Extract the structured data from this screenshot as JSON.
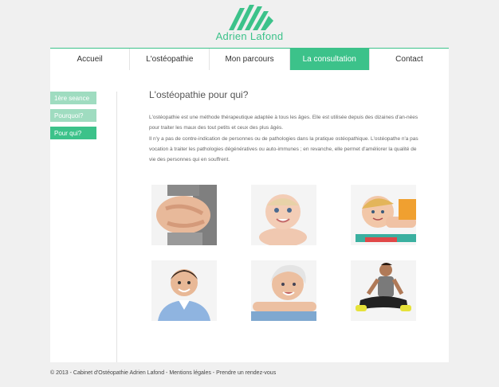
{
  "brand": {
    "name": "Adrien Lafond",
    "accent_color": "#3cc28a",
    "light_accent": "#9fdcc0"
  },
  "nav": {
    "items": [
      {
        "label": "Accueil",
        "active": false
      },
      {
        "label": "L'ostéopathie",
        "active": false
      },
      {
        "label": "Mon parcours",
        "active": false
      },
      {
        "label": "La consultation",
        "active": true
      },
      {
        "label": "Contact",
        "active": false
      }
    ]
  },
  "side_menu": {
    "items": [
      {
        "label": "1ère seance",
        "active": false
      },
      {
        "label": "Pourquoi?",
        "active": false
      },
      {
        "label": "Pour qui?",
        "active": true
      }
    ]
  },
  "main": {
    "title": "L'ostéopathie pour qui?",
    "paragraph1": "L'ostéopathie est une méthode thérapeutique adaptée à tous les âges. Elle est utilisée depuis des dizaines d'an-nées pour traiter les maux des tout petits et ceux des plus âgés.",
    "paragraph2": "Il n'y a pas de contre-indication de personnes ou de pathologies dans la pratique ostéopathique. L'ostéopathe n'a pas vocation à traiter les pathologies dégénératives ou auto-immunes ; en revanche, elle permet d'améliorer la qualité de vie des personnes qui en souffrent.",
    "photos": [
      {
        "icon": "pregnant-belly-photo"
      },
      {
        "icon": "baby-photo"
      },
      {
        "icon": "child-photo"
      },
      {
        "icon": "man-photo"
      },
      {
        "icon": "senior-woman-photo"
      },
      {
        "icon": "athlete-photo"
      }
    ]
  },
  "footer": {
    "copyright": "© 2013 - Cabinet d'Ostéopathie Adrien Lafond",
    "sep1": " - ",
    "legal": "Mentions légales",
    "sep2": " - ",
    "appointment": "Prendre un rendez-vous"
  }
}
